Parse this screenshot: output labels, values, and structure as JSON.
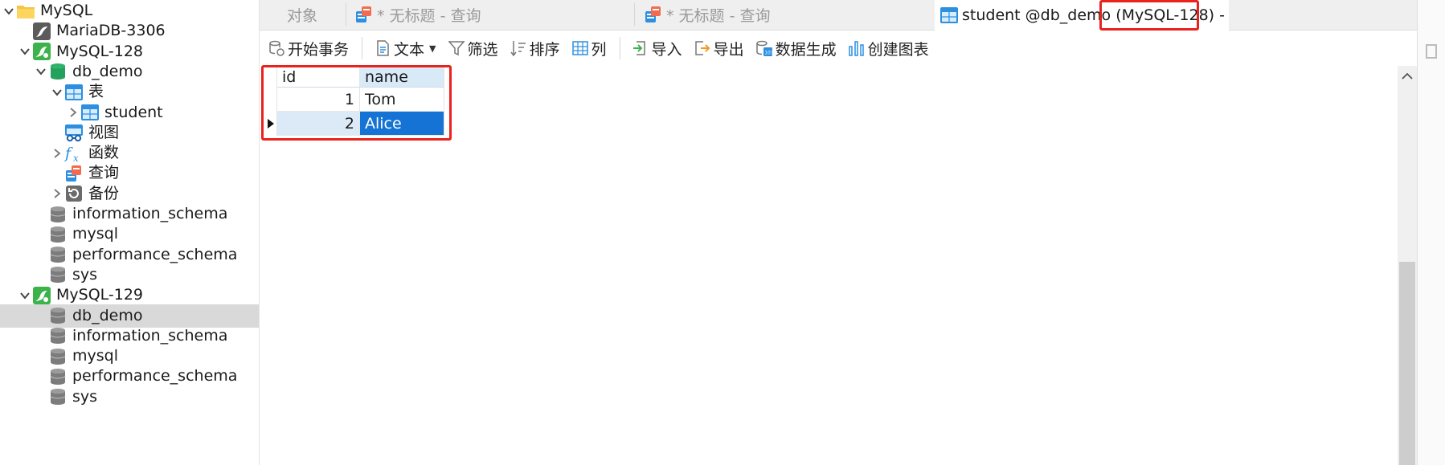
{
  "sidebar": {
    "items": [
      {
        "label": "MySQL",
        "icon": "folder-icon",
        "chev": "down",
        "indent": 0
      },
      {
        "label": "MariaDB-3306",
        "icon": "mariadb-connection-icon",
        "chev": "none",
        "indent": 1
      },
      {
        "label": "MySQL-128",
        "icon": "mysql-connection-icon",
        "chev": "down",
        "indent": 1
      },
      {
        "label": "db_demo",
        "icon": "database-open-icon",
        "chev": "down",
        "indent": 2
      },
      {
        "label": "表",
        "icon": "tables-icon",
        "chev": "down",
        "indent": 3
      },
      {
        "label": "student",
        "icon": "table-icon",
        "chev": "right",
        "indent": 4
      },
      {
        "label": "视图",
        "icon": "views-icon",
        "chev": "none",
        "indent": 3
      },
      {
        "label": "函数",
        "icon": "function-icon",
        "chev": "right",
        "indent": 3
      },
      {
        "label": "查询",
        "icon": "query-icon",
        "chev": "none",
        "indent": 3
      },
      {
        "label": "备份",
        "icon": "backup-icon",
        "chev": "right",
        "indent": 3
      },
      {
        "label": "information_schema",
        "icon": "database-icon",
        "chev": "none",
        "indent": 2
      },
      {
        "label": "mysql",
        "icon": "database-icon",
        "chev": "none",
        "indent": 2
      },
      {
        "label": "performance_schema",
        "icon": "database-icon",
        "chev": "none",
        "indent": 2
      },
      {
        "label": "sys",
        "icon": "database-icon",
        "chev": "none",
        "indent": 2
      },
      {
        "label": "MySQL-129",
        "icon": "mysql-connection-icon",
        "chev": "down",
        "indent": 1
      },
      {
        "label": "db_demo",
        "icon": "database-icon",
        "chev": "none",
        "indent": 2,
        "selected": true
      },
      {
        "label": "information_schema",
        "icon": "database-icon",
        "chev": "none",
        "indent": 2
      },
      {
        "label": "mysql",
        "icon": "database-icon",
        "chev": "none",
        "indent": 2
      },
      {
        "label": "performance_schema",
        "icon": "database-icon",
        "chev": "none",
        "indent": 2
      },
      {
        "label": "sys",
        "icon": "database-icon",
        "chev": "none",
        "indent": 2
      }
    ]
  },
  "tabs": [
    {
      "label": "对象",
      "icon": "none",
      "active": false
    },
    {
      "label": "* 无标题 - 查询",
      "icon": "query-icon",
      "active": false
    },
    {
      "label": "* 无标题 - 查询",
      "icon": "query-icon",
      "active": false
    },
    {
      "label": "student @db_demo (MySQL-128) - ...",
      "icon": "table-icon",
      "active": true
    }
  ],
  "toolbar": {
    "begin_transaction": "开始事务",
    "text": "文本",
    "filter": "筛选",
    "sort": "排序",
    "columns": "列",
    "import": "导入",
    "export": "导出",
    "data_generation": "数据生成",
    "create_chart": "创建图表"
  },
  "grid": {
    "columns": [
      "id",
      "name"
    ],
    "rows": [
      {
        "id": "1",
        "name": "Tom"
      },
      {
        "id": "2",
        "name": "Alice"
      }
    ]
  },
  "colors": {
    "highlight": "#e8231d",
    "selection": "#1473d4",
    "mysql_green": "#3cb34a"
  }
}
